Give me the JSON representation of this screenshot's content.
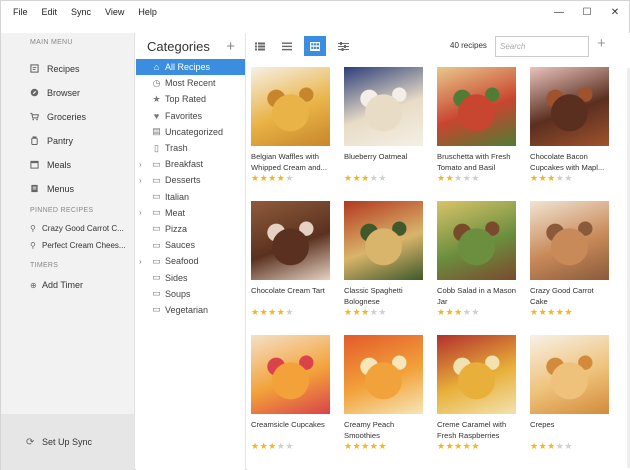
{
  "menubar": {
    "items": [
      "File",
      "Edit",
      "Sync",
      "View",
      "Help"
    ]
  },
  "window_controls": {
    "minimize": "—",
    "maximize": "☐",
    "close": "✕"
  },
  "sidebar": {
    "main_menu_label": "MAIN MENU",
    "items": [
      {
        "label": "Recipes",
        "icon": "recipes-icon",
        "active": true
      },
      {
        "label": "Browser",
        "icon": "compass-icon",
        "active": false
      },
      {
        "label": "Groceries",
        "icon": "cart-icon",
        "active": false
      },
      {
        "label": "Pantry",
        "icon": "pantry-icon",
        "active": false
      },
      {
        "label": "Meals",
        "icon": "calendar-icon",
        "active": false
      },
      {
        "label": "Menus",
        "icon": "menu-book-icon",
        "active": false
      }
    ],
    "pinned_label": "PINNED RECIPES",
    "pinned": [
      "Crazy Good Carrot C...",
      "Perfect Cream Chees..."
    ],
    "timers_label": "TIMERS",
    "add_timer": "Add Timer",
    "setup_sync": "Set Up Sync"
  },
  "categories": {
    "title": "Categories",
    "add": "+",
    "items": [
      {
        "label": "All Recipes",
        "icon": "home-icon",
        "selected": true,
        "expandable": false
      },
      {
        "label": "Most Recent",
        "icon": "clock-icon",
        "selected": false,
        "expandable": false
      },
      {
        "label": "Top Rated",
        "icon": "star-icon",
        "selected": false,
        "expandable": false
      },
      {
        "label": "Favorites",
        "icon": "heart-icon",
        "selected": false,
        "expandable": false
      },
      {
        "label": "Uncategorized",
        "icon": "uncategorized-icon",
        "selected": false,
        "expandable": false
      },
      {
        "label": "Trash",
        "icon": "trash-icon",
        "selected": false,
        "expandable": false
      },
      {
        "label": "Breakfast",
        "icon": "folder-icon",
        "selected": false,
        "expandable": true
      },
      {
        "label": "Desserts",
        "icon": "folder-icon",
        "selected": false,
        "expandable": true
      },
      {
        "label": "Italian",
        "icon": "folder-icon",
        "selected": false,
        "expandable": false
      },
      {
        "label": "Meat",
        "icon": "folder-icon",
        "selected": false,
        "expandable": true
      },
      {
        "label": "Pizza",
        "icon": "folder-icon",
        "selected": false,
        "expandable": false
      },
      {
        "label": "Sauces",
        "icon": "folder-icon",
        "selected": false,
        "expandable": false
      },
      {
        "label": "Seafood",
        "icon": "folder-icon",
        "selected": false,
        "expandable": true
      },
      {
        "label": "Sides",
        "icon": "folder-icon",
        "selected": false,
        "expandable": false
      },
      {
        "label": "Soups",
        "icon": "folder-icon",
        "selected": false,
        "expandable": false
      },
      {
        "label": "Vegetarian",
        "icon": "folder-icon",
        "selected": false,
        "expandable": false
      }
    ]
  },
  "toolbar": {
    "recipe_count": "40 recipes",
    "search_placeholder": "Search",
    "add": "+",
    "active_view": "grid"
  },
  "recipes": [
    {
      "title": "Belgian Waffles with Whipped Cream and...",
      "rating": 4,
      "colors": [
        "#e9b347",
        "#f6f0e6",
        "#c7862b"
      ]
    },
    {
      "title": "Blueberry Oatmeal",
      "rating": 3,
      "colors": [
        "#e8dcc6",
        "#2d3f7a",
        "#f4efe6"
      ]
    },
    {
      "title": "Bruschetta with Fresh Tomato and Basil",
      "rating": 2,
      "colors": [
        "#c8452f",
        "#e9c88b",
        "#4f7d34"
      ]
    },
    {
      "title": "Chocolate Bacon Cupcakes with Mapl...",
      "rating": 3,
      "colors": [
        "#5a2f1f",
        "#e9c3bd",
        "#a0522d"
      ]
    },
    {
      "title": "Chocolate Cream Tart",
      "rating": 4,
      "colors": [
        "#5a3120",
        "#8f5b3a",
        "#e6d2c2"
      ]
    },
    {
      "title": "Classic Spaghetti Bolognese",
      "rating": 3,
      "colors": [
        "#d9b46b",
        "#b3381f",
        "#3f5a2a"
      ]
    },
    {
      "title": "Cobb Salad in a Mason Jar",
      "rating": 3,
      "colors": [
        "#6b8f3e",
        "#d9c36a",
        "#7a4a2d"
      ]
    },
    {
      "title": "Crazy Good Carrot Cake",
      "rating": 5,
      "colors": [
        "#c98a5a",
        "#f1e4d3",
        "#8a5a3a"
      ]
    },
    {
      "title": "Creamsicle Cupcakes",
      "rating": 3,
      "colors": [
        "#f3a23a",
        "#f4e0c5",
        "#d9434a"
      ]
    },
    {
      "title": "Creamy Peach Smoothies",
      "rating": 5,
      "colors": [
        "#f2a23a",
        "#e45a2a",
        "#f6e6b8"
      ]
    },
    {
      "title": "Creme Caramel with Fresh Raspberries",
      "rating": 5,
      "colors": [
        "#e8b03a",
        "#b3302c",
        "#f3e2b0"
      ]
    },
    {
      "title": "Crepes",
      "rating": 3,
      "colors": [
        "#eec27a",
        "#f7f1e6",
        "#d38a3a"
      ]
    }
  ]
}
